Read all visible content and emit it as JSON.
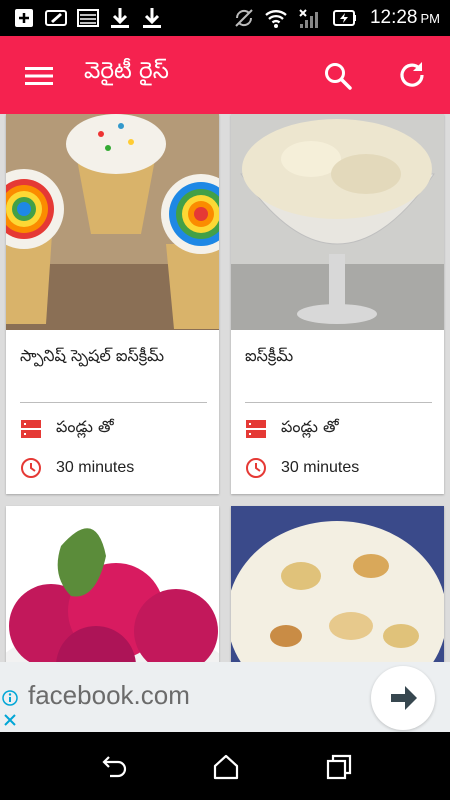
{
  "status_bar": {
    "time": "12:28",
    "ampm": "PM",
    "left_icons": [
      "add-box-icon",
      "edit-icon",
      "image-icon",
      "download-icon",
      "download-icon"
    ],
    "right_icons": [
      "sync-disabled-icon",
      "wifi-icon",
      "signal-icon",
      "battery-charging-icon"
    ]
  },
  "app_bar": {
    "title": "వెరైటీ రైస్",
    "color": "#f5224f",
    "menu_icon": "menu-icon",
    "search_icon": "search-icon",
    "refresh_icon": "refresh-icon"
  },
  "recipes": [
    {
      "title": "స్పానిష్ స్పెషల్ ఐస్‌క్రీమ్",
      "category": "పండ్లు తో",
      "time": "30 minutes",
      "image": "rainbow-cupcake-cones"
    },
    {
      "title": "ఐస్‌క్రీమ్",
      "category": "పండ్లు తో",
      "time": "30 minutes",
      "image": "vanilla-ice-cream-glass"
    },
    {
      "title": "",
      "category": "",
      "time": "",
      "image": "pink-ice-cream-scoops"
    },
    {
      "title": "",
      "category": "",
      "time": "",
      "image": "fruit-ice-cream"
    }
  ],
  "ad": {
    "text": "facebook.com",
    "info_icon": "info-icon",
    "close_icon": "close-icon",
    "action_icon": "arrow-right-icon"
  },
  "nav_bar": {
    "back_icon": "back-icon",
    "home_icon": "home-icon",
    "recents_icon": "recents-icon"
  }
}
